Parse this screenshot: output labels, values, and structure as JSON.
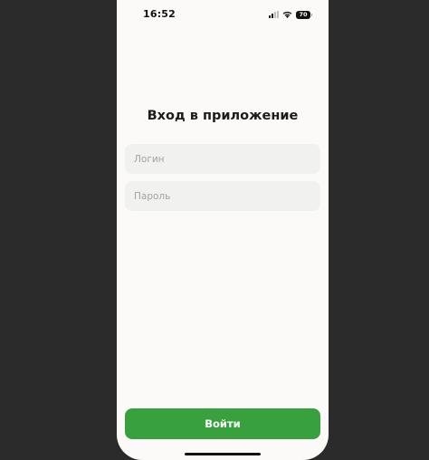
{
  "status_bar": {
    "time": "16:52",
    "battery_level": "70",
    "icons": [
      "signal-icon",
      "wifi-icon",
      "battery-icon"
    ]
  },
  "screen": {
    "title": "Вход в приложение"
  },
  "form": {
    "login_placeholder": "Логин",
    "login_value": "",
    "password_placeholder": "Пароль",
    "password_value": "",
    "submit_label": "Войти"
  },
  "colors": {
    "screen_background": "#fbfaf8",
    "field_background": "#f1f1f0",
    "accent": "#38a13e",
    "backdrop": "#2b2b2b"
  }
}
